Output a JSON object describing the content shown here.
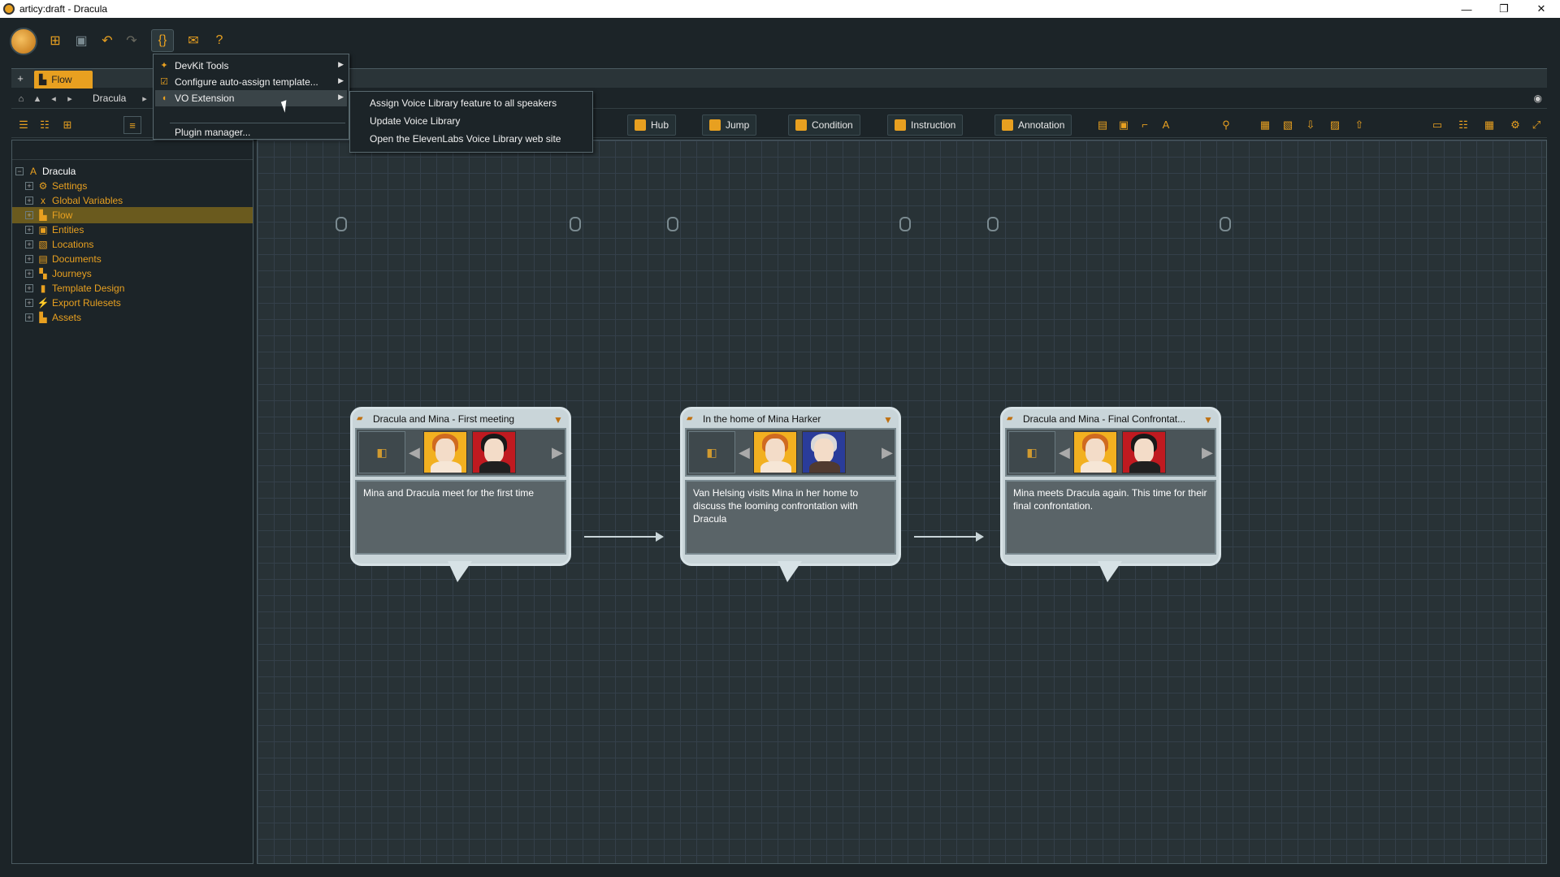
{
  "window": {
    "title": "articy:draft - Dracula",
    "minimize": "—",
    "restore": "❐",
    "close": "✕"
  },
  "tabs": {
    "add": "+",
    "active": "Flow"
  },
  "breadcrumb": {
    "label": "Dracula"
  },
  "flow_toolbar": {
    "hub": "Hub",
    "jump": "Jump",
    "condition": "Condition",
    "instruction": "Instruction",
    "annotation": "Annotation"
  },
  "plugin_menu": {
    "items": [
      {
        "label": "DevKit Tools",
        "icon": "puzzle-icon",
        "has_submenu": true
      },
      {
        "label": "Configure auto-assign template...",
        "icon": "checkbox-icon",
        "has_submenu": true
      },
      {
        "label": "VO Extension",
        "icon": "voice-icon",
        "has_submenu": true
      },
      {
        "label": "Plugin manager...",
        "icon": "",
        "has_submenu": false
      }
    ]
  },
  "vo_submenu": {
    "items": [
      {
        "label": "Assign Voice Library feature to all speakers"
      },
      {
        "label": "Update Voice Library"
      },
      {
        "label": "Open the ElevenLabs Voice Library web site"
      }
    ]
  },
  "tree": {
    "root": "Dracula",
    "items": [
      {
        "label": "Settings",
        "icon": "gear-icon"
      },
      {
        "label": "Global Variables",
        "icon": "variables-icon"
      },
      {
        "label": "Flow",
        "icon": "flow-icon",
        "selected": true
      },
      {
        "label": "Entities",
        "icon": "entities-icon"
      },
      {
        "label": "Locations",
        "icon": "locations-icon"
      },
      {
        "label": "Documents",
        "icon": "documents-icon"
      },
      {
        "label": "Journeys",
        "icon": "journeys-icon"
      },
      {
        "label": "Template Design",
        "icon": "template-icon"
      },
      {
        "label": "Export Rulesets",
        "icon": "export-icon"
      },
      {
        "label": "Assets",
        "icon": "assets-icon"
      }
    ]
  },
  "nodes": [
    {
      "title": "Dracula and Mina - First meeting",
      "text": "Mina and Dracula meet for the first time"
    },
    {
      "title": "In the home of Mina Harker",
      "text": "Van Helsing visits Mina in her home to discuss the looming confrontation with Dracula"
    },
    {
      "title": "Dracula and Mina - Final Confrontat...",
      "text": "Mina meets Dracula again. This time for their final confrontation."
    }
  ],
  "colors": {
    "accent": "#e8a020",
    "background": "#1c2428",
    "canvas": "#283236",
    "node": "#c9d5d9",
    "selected": "#6a5a1e"
  }
}
